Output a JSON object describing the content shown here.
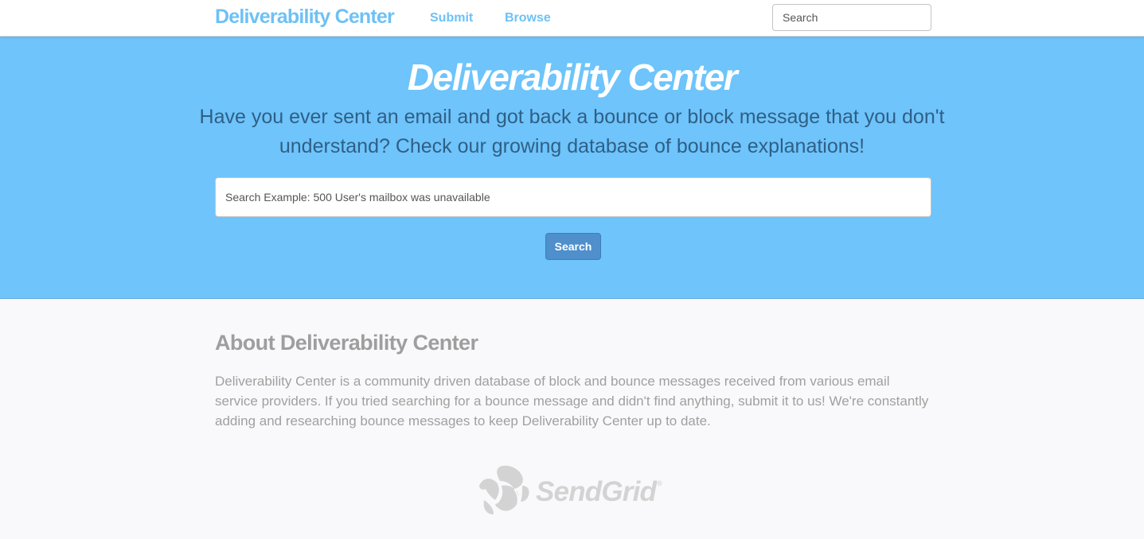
{
  "navbar": {
    "brand": "Deliverability Center",
    "links": [
      {
        "label": "Submit"
      },
      {
        "label": "Browse"
      }
    ],
    "search_placeholder": "Search"
  },
  "hero": {
    "title": "Deliverability Center",
    "subtitle": "Have you ever sent an email and got back a bounce or block message that you don't understand? Check our growing database of bounce explanations!",
    "search_placeholder": "Search Example: 500 User's mailbox was unavailable",
    "button_label": "Search"
  },
  "about": {
    "title": "About Deliverability Center",
    "text": "Deliverability Center is a community driven database of block and bounce messages received from various email service providers. If you tried searching for a bounce message and didn't find anything, submit it to us! We're constantly adding and researching bounce messages to keep Deliverability Center up to date."
  },
  "footer": {
    "logo_text": "SendGrid",
    "logo_mark": "®",
    "logo_icon": "sendgrid-logo-icon"
  },
  "colors": {
    "accent": "#6ec1f5",
    "hero_background": "#6ec4fb",
    "hero_subtitle": "#2f5f86",
    "button": "#4e8fcc",
    "muted_text": "#a0a0a0",
    "logo_gray": "#d3d3d3"
  }
}
